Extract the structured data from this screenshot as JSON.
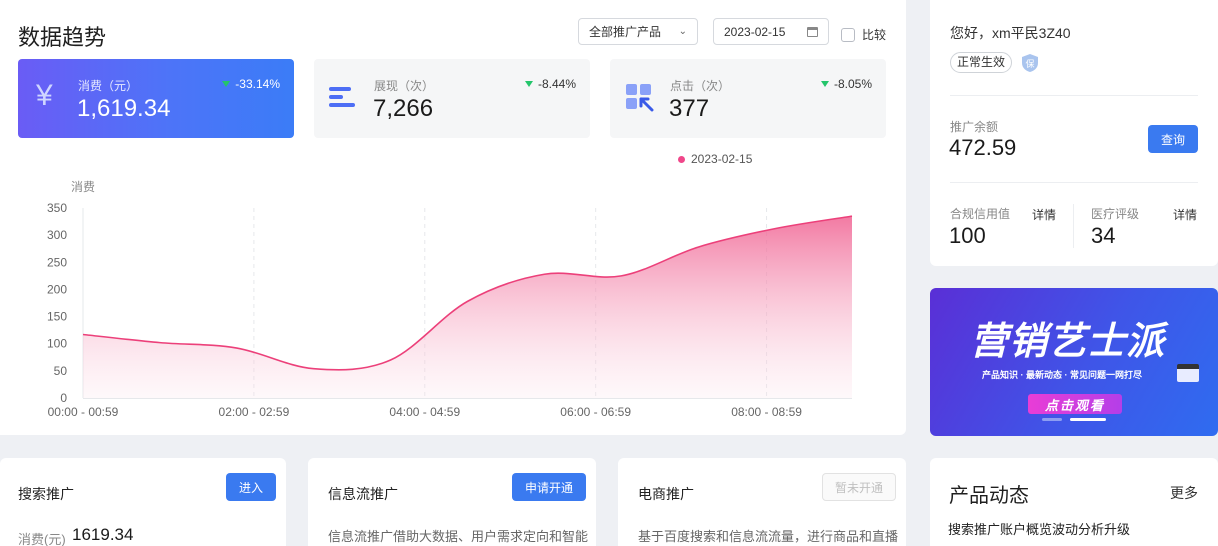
{
  "trend": {
    "title": "数据趋势",
    "product_select": "全部推广产品",
    "date_value": "2023-02-15",
    "compare_label": "比较",
    "metrics": [
      {
        "label": "消费（元）",
        "value": "1,619.34",
        "change": "-33.14%"
      },
      {
        "label": "展现（次）",
        "value": "7,266",
        "change": "-8.44%"
      },
      {
        "label": "点击（次）",
        "value": "377",
        "change": "-8.05%"
      }
    ],
    "legend": "2023-02-15",
    "colors": {
      "accent": "#3a7af0",
      "series": "#f06292",
      "down": "#24c56b"
    }
  },
  "chart_data": {
    "type": "area",
    "ylabel": "消费",
    "ylim": [
      0,
      350
    ],
    "yticks": [
      "350",
      "300",
      "250",
      "200",
      "150",
      "100",
      "50",
      "0"
    ],
    "xticks": [
      "00:00 - 00:59",
      "02:00 - 02:59",
      "04:00 - 04:59",
      "06:00 - 06:59",
      "08:00 - 08:59"
    ],
    "series": [
      {
        "name": "2023-02-15",
        "values": [
          117,
          102,
          92,
          54,
          70,
          178,
          228,
          225,
          278,
          312,
          335
        ]
      }
    ]
  },
  "account": {
    "greeting": "您好，xm平民3Z40",
    "status": "正常生效",
    "balance_label": "推广余额",
    "balance_value": "472.59",
    "query_btn": "查询",
    "credit_label": "合规信用值",
    "credit_detail": "详情",
    "credit_value": "100",
    "medical_label": "医疗评级",
    "medical_detail": "详情",
    "medical_value": "34"
  },
  "banner": {
    "title": "营销艺士派",
    "subtitle": "产品知识 · 最新动态 · 常见问题一网打尽",
    "cta": "点击观看"
  },
  "cards": {
    "search": {
      "title": "搜索推广",
      "btn": "进入",
      "spend_label": "消费(元)",
      "spend_value": "1619.34"
    },
    "feed": {
      "title": "信息流推广",
      "btn": "申请开通",
      "desc": "信息流推广借助大数据、用户需求定向和智能"
    },
    "ecom": {
      "title": "电商推广",
      "btn": "暂未开通",
      "desc": "基于百度搜索和信息流流量，进行商品和直播"
    },
    "news": {
      "title": "产品动态",
      "more": "更多",
      "item": "搜索推广账户概览波动分析升级"
    }
  }
}
